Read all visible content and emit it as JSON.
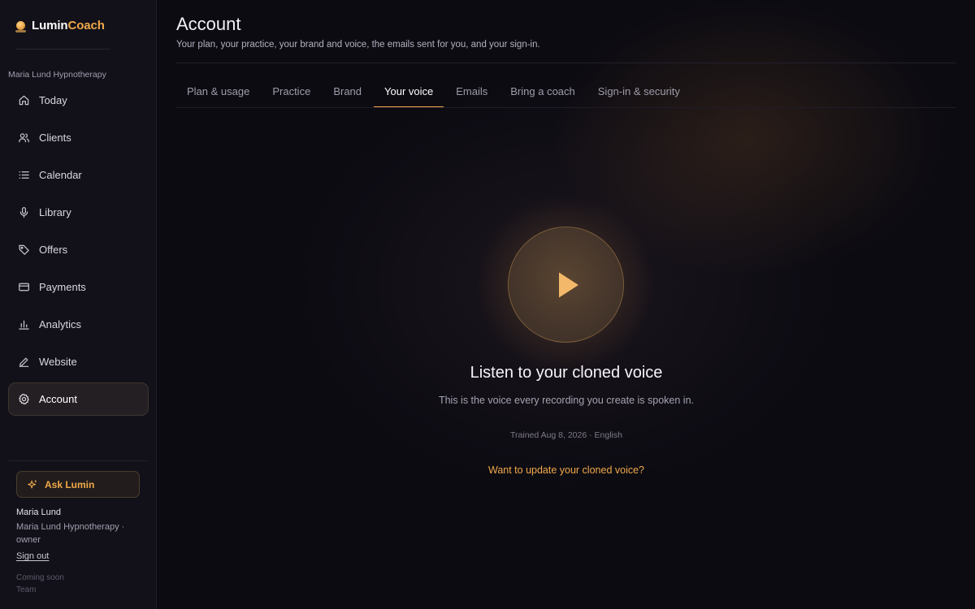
{
  "brand": {
    "name_a": "Lumin",
    "name_b": "Coach"
  },
  "sidebar": {
    "org": "Maria Lund Hypnotherapy",
    "items": [
      {
        "label": "Today",
        "icon": "home-icon"
      },
      {
        "label": "Clients",
        "icon": "users-icon"
      },
      {
        "label": "Calendar",
        "icon": "list-icon"
      },
      {
        "label": "Library",
        "icon": "microphone-icon"
      },
      {
        "label": "Offers",
        "icon": "tag-icon"
      },
      {
        "label": "Payments",
        "icon": "credit-card-icon"
      },
      {
        "label": "Analytics",
        "icon": "bar-chart-icon"
      },
      {
        "label": "Website",
        "icon": "pencil-icon"
      },
      {
        "label": "Account",
        "icon": "gear-icon",
        "active": true
      }
    ],
    "ask_label": "Ask Lumin",
    "user_name": "Maria Lund",
    "user_org": "Maria Lund Hypnotherapy · owner",
    "sign_out": "Sign out",
    "coming_soon": "Coming soon",
    "team": "Team"
  },
  "header": {
    "title": "Account",
    "subtitle": "Your plan, your practice, your brand and voice, the emails sent for you, and your sign-in."
  },
  "tabs": [
    {
      "label": "Plan & usage"
    },
    {
      "label": "Practice"
    },
    {
      "label": "Brand"
    },
    {
      "label": "Your voice",
      "active": true
    },
    {
      "label": "Emails"
    },
    {
      "label": "Bring a coach"
    },
    {
      "label": "Sign-in & security"
    }
  ],
  "voice": {
    "title": "Listen to your cloned voice",
    "description": "This is the voice every recording you create is spoken in.",
    "meta": "Trained Aug 8, 2026 · English",
    "update_link": "Want to update your cloned voice?"
  },
  "colors": {
    "accent": "#f0a94a",
    "background": "#0c0b12",
    "sidebar": "#121119"
  }
}
